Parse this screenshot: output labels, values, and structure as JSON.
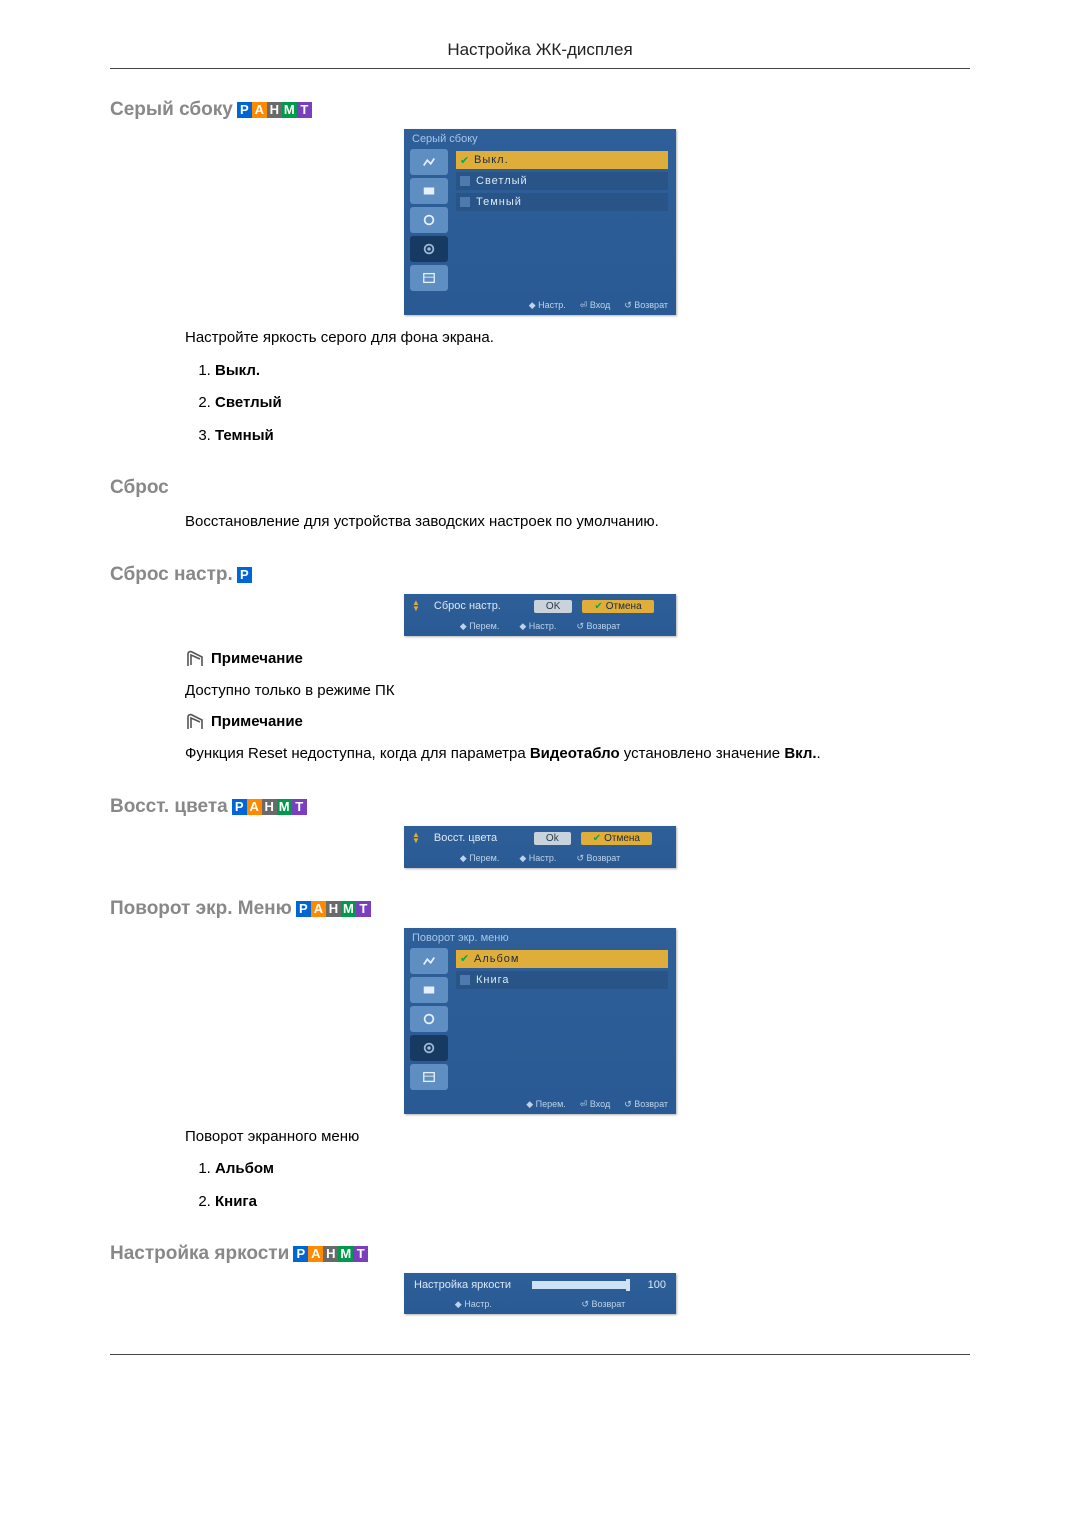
{
  "header": {
    "title": "Настройка ЖК-дисплея"
  },
  "pahmt": {
    "p": "P",
    "a": "A",
    "h": "H",
    "m": "M",
    "t": "T"
  },
  "section1": {
    "title": "Серый сбоку",
    "osd_title": "Серый сбоку",
    "items": [
      {
        "label": "Выкл.",
        "selected": true,
        "bullet": "✔"
      },
      {
        "label": "Светлый",
        "selected": false
      },
      {
        "label": "Темный",
        "selected": false
      }
    ],
    "footer": {
      "a": "◆ Настр.",
      "b": "⏎ Вход",
      "c": "↺ Возврат"
    },
    "desc": "Настройте яркость серого для фона экрана.",
    "opts": [
      "Выкл.",
      "Светлый",
      "Темный"
    ]
  },
  "section2": {
    "title": "Сброс",
    "desc": "Восстановление для устройства заводских настроек по умолчанию."
  },
  "section3": {
    "title": "Сброс настр.",
    "osd_title": "Сброс настр.",
    "ok": "OK",
    "cancel": "Отмена",
    "footer": {
      "a": "◆ Перем.",
      "b": "◆ Настр.",
      "c": "↺ Возврат"
    },
    "note_label": "Примечание",
    "note1": "Доступно только в режиме ПК",
    "note2_pre": "Функция Reset недоступна, когда для параметра ",
    "note2_bold1": "Видеотабло",
    "note2_mid": " установлено значение ",
    "note2_bold2": "Вкл.",
    "note2_end": "."
  },
  "section4": {
    "title": "Восст. цвета",
    "osd_title": "Восст. цвета",
    "ok": "Ok",
    "cancel": "Отмена",
    "footer": {
      "a": "◆ Перем.",
      "b": "◆ Настр.",
      "c": "↺ Возврат"
    }
  },
  "section5": {
    "title": "Поворот экр. Меню",
    "osd_title": "Поворот экр. меню",
    "items": [
      {
        "label": "Альбом",
        "selected": true,
        "bullet": "✔"
      },
      {
        "label": "Книга",
        "selected": false
      }
    ],
    "footer": {
      "a": "◆ Перем.",
      "b": "⏎ Вход",
      "c": "↺ Возврат"
    },
    "desc": "Поворот экранного меню",
    "opts": [
      "Альбом",
      "Книга"
    ]
  },
  "section6": {
    "title": "Настройка яркости",
    "osd_title": "Настройка яркости",
    "value": "100",
    "footer": {
      "a": "◆ Настр.",
      "b": "↺ Возврат"
    }
  }
}
